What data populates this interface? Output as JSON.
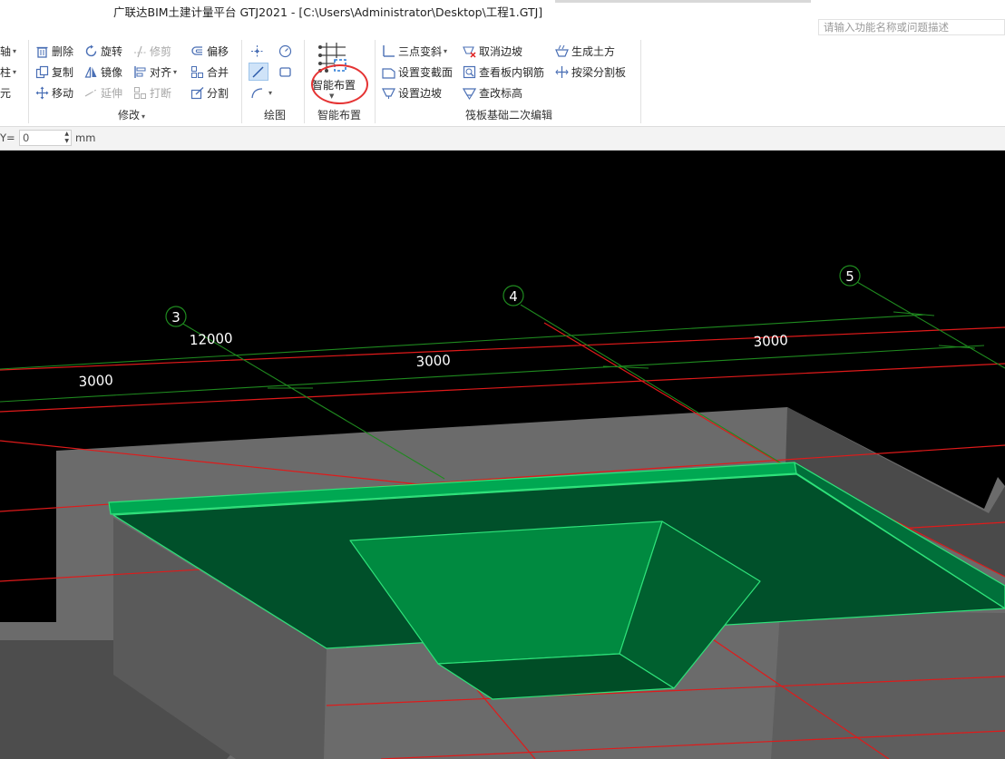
{
  "window": {
    "title": "广联达BIM土建计量平台 GTJ2021 - [C:\\Users\\Administrator\\Desktop\\工程1.GTJ]",
    "search_placeholder": "请输入功能名称或问题描述"
  },
  "ribbon": {
    "left_partial": [
      "轴",
      "柱",
      "元"
    ],
    "modify": {
      "delete": "删除",
      "rotate": "旋转",
      "trim": "修剪",
      "offset": "偏移",
      "copy": "复制",
      "mirror": "镜像",
      "align": "对齐",
      "merge": "合并",
      "move": "移动",
      "extend": "延伸",
      "break": "打断",
      "split": "分割",
      "group_label": "修改"
    },
    "draw": {
      "group_label": "绘图"
    },
    "smart": {
      "button_label": "智能布置",
      "group_label": "智能布置"
    },
    "raft_edit": {
      "three_point_slope": "三点变斜",
      "cancel_slope": "取消边坡",
      "gen_earthwork": "生成土方",
      "set_section": "设置变截面",
      "view_rebar": "查看板内钢筋",
      "split_by_beam": "按梁分割板",
      "set_slope": "设置边坡",
      "edit_elevation": "查改标高",
      "group_label": "筏板基础二次编辑"
    }
  },
  "propbar": {
    "y_label": "Y=",
    "y_value": "0",
    "unit": "mm"
  },
  "viewport": {
    "axis_labels": [
      "3",
      "4",
      "5"
    ],
    "dimensions": {
      "total": "12000",
      "span_1": "3000",
      "span_2": "3000",
      "span_3": "3000"
    }
  },
  "colors": {
    "grid_green": "#1f8a1f",
    "axis_red": "#e01a1a",
    "slab_top": "#00502a",
    "slab_edge": "#2ee27a",
    "pit_face": "#008a40",
    "wall": "#6b6b6b",
    "highlight": "#e53333"
  }
}
